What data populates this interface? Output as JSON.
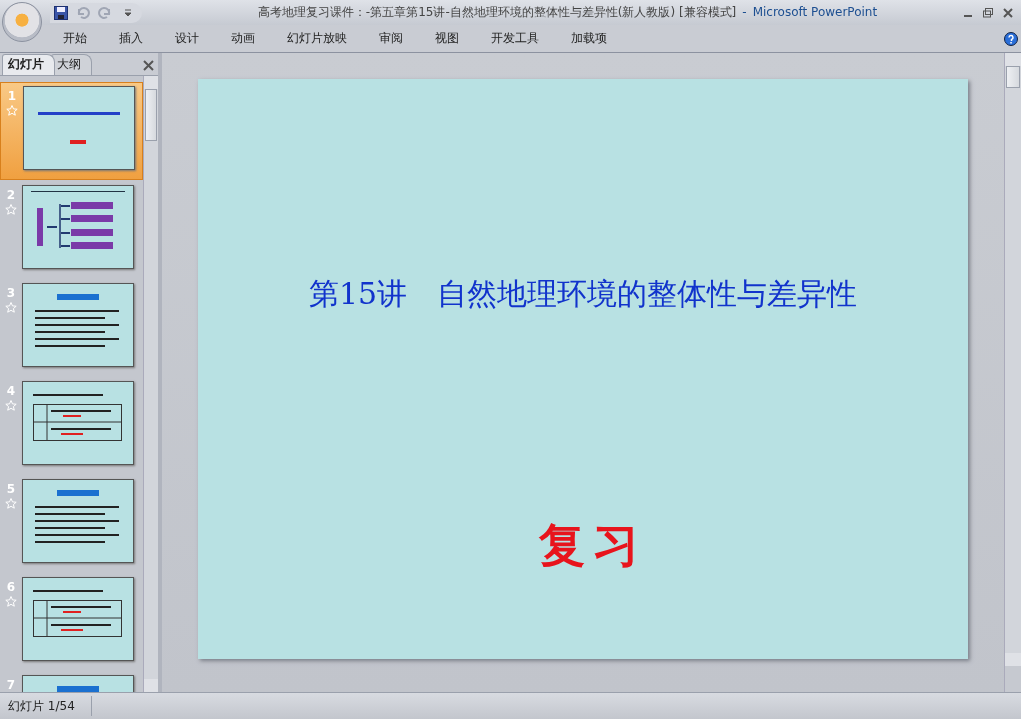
{
  "window": {
    "title": "高考地理复习课件：-第五章第15讲-自然地理环境的整体性与差异性(新人教版) [兼容模式]",
    "separator": "-",
    "app_name": "Microsoft PowerPoint"
  },
  "ribbon_tabs": [
    {
      "label": "开始"
    },
    {
      "label": "插入"
    },
    {
      "label": "设计"
    },
    {
      "label": "动画"
    },
    {
      "label": "幻灯片放映"
    },
    {
      "label": "审阅"
    },
    {
      "label": "视图"
    },
    {
      "label": "开发工具"
    },
    {
      "label": "加载项"
    }
  ],
  "panel_tabs": [
    {
      "label": "幻灯片",
      "selected": true
    },
    {
      "label": "大纲",
      "selected": false
    }
  ],
  "thumbnails": [
    {
      "number": "1",
      "kind": "title",
      "selected": true
    },
    {
      "number": "2",
      "kind": "diagram",
      "selected": false
    },
    {
      "number": "3",
      "kind": "text",
      "selected": false
    },
    {
      "number": "4",
      "kind": "table",
      "selected": false
    },
    {
      "number": "5",
      "kind": "text",
      "selected": false
    },
    {
      "number": "6",
      "kind": "table",
      "selected": false
    },
    {
      "number": "7",
      "kind": "text",
      "selected": false
    }
  ],
  "slide": {
    "title": "第15讲　自然地理环境的整体性与差异性",
    "subtitle": "复习"
  },
  "status_bar": {
    "slide_counter": "幻灯片 1/54"
  }
}
